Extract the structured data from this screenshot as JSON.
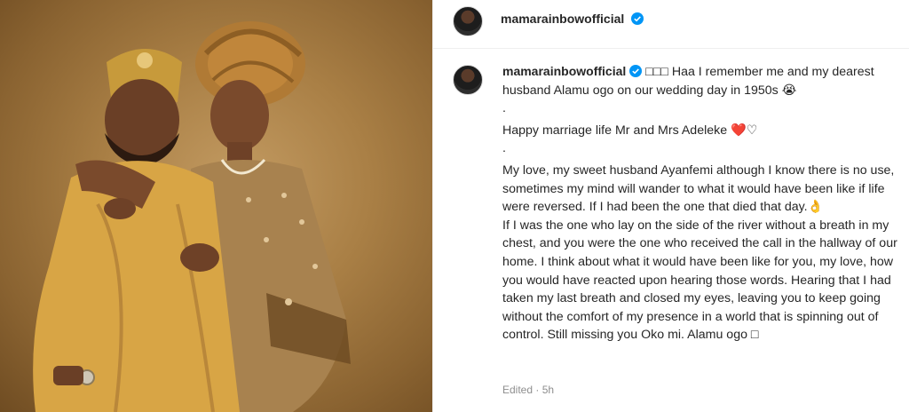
{
  "post": {
    "username": "mamarainbowofficial",
    "caption_first": "□□□ Haa I remember me and my dearest husband Alamu ogo on our wedding day in 1950s 😭",
    "dot1": ".",
    "line2": "Happy marriage life Mr and Mrs Adeleke ❤️♡",
    "dot2": ".",
    "para1": "My love, my sweet husband Ayanfemi although I know there is no use, sometimes my mind will wander to what it would have been like if life were reversed. If I had been the one that died that day.👌",
    "para2": "If I was the one who lay on the side of the river without a breath in my chest, and you were the one who received the call in the hallway of our home. I think about what it would have been like for you, my love, how you would have reacted upon hearing those words. Hearing that I had taken my last breath and closed my eyes, leaving you to keep going without the comfort of my presence in a world that is spinning out of control. Still missing you Oko mi. Alamu ogo □",
    "meta": "Edited · 5h"
  },
  "colors": {
    "verified": "#0095f6",
    "heart": "#ed4956",
    "photo_bg": "#a97f45"
  },
  "icons": [
    "verified-icon",
    "avatar"
  ]
}
